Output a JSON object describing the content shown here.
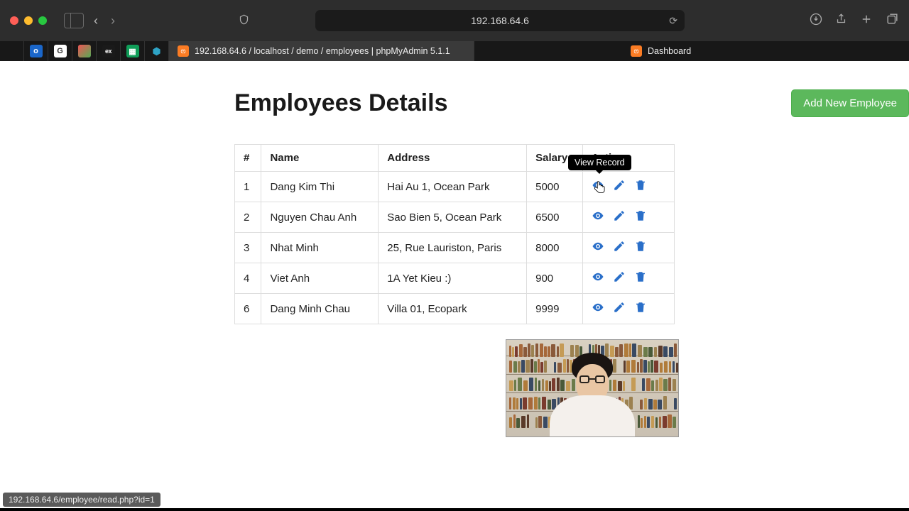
{
  "browser": {
    "url": "192.168.64.6",
    "tab_title": "192.168.64.6 / localhost / demo / employees | phpMyAdmin 5.1.1",
    "tab2_title": "Dashboard"
  },
  "page": {
    "title": "Employees Details",
    "add_button": "Add New Employee"
  },
  "table": {
    "headers": {
      "id": "#",
      "name": "Name",
      "address": "Address",
      "salary": "Salary",
      "action": "Action"
    },
    "rows": [
      {
        "id": "1",
        "name": "Dang Kim Thi",
        "address": "Hai Au 1, Ocean Park",
        "salary": "5000"
      },
      {
        "id": "2",
        "name": "Nguyen Chau Anh",
        "address": "Sao Bien 5, Ocean Park",
        "salary": "6500"
      },
      {
        "id": "3",
        "name": "Nhat Minh",
        "address": "25, Rue Lauriston, Paris",
        "salary": "8000"
      },
      {
        "id": "4",
        "name": "Viet Anh",
        "address": "1A Yet Kieu :)",
        "salary": "900"
      },
      {
        "id": "6",
        "name": "Dang Minh Chau",
        "address": "Villa 01, Ecopark",
        "salary": "9999"
      }
    ]
  },
  "tooltip": "View Record",
  "status_bar": "192.168.64.6/employee/read.php?id=1"
}
